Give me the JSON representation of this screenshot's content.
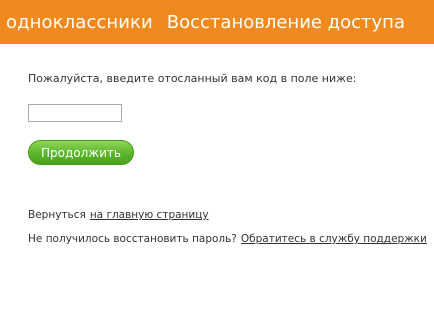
{
  "header": {
    "brand": "одноклассники",
    "title": "Восстановление доступа",
    "background": "#f18a1e"
  },
  "form": {
    "instruction": "Пожалуйста, введите отосланный вам код в поле ниже:",
    "code_value": "",
    "continue_label": "Продолжить",
    "button_color": "#5cb52b"
  },
  "links": {
    "return_prefix": "Вернуться",
    "home_link": "на главную страницу",
    "support_prefix": "Не получилось восстановить пароль?",
    "support_link": "Обратитесь в службу поддержки"
  }
}
